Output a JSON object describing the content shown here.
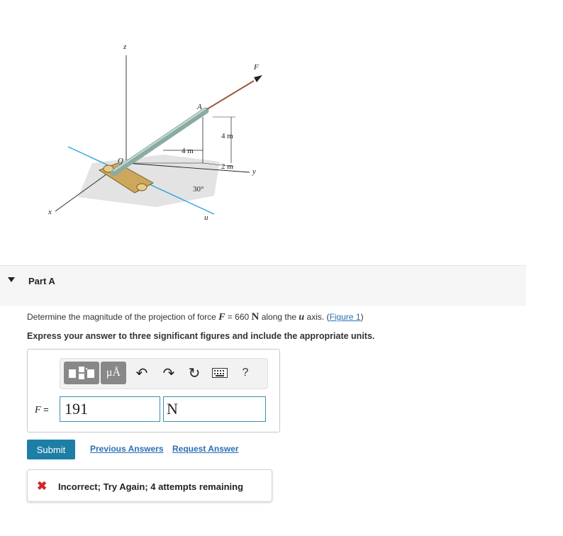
{
  "figure": {
    "labels": {
      "z": "z",
      "x": "x",
      "y": "y",
      "u": "u",
      "O": "O",
      "A": "A",
      "F": "F",
      "dim_4m_horizontal": "4 m",
      "dim_4m_vertical": "4 m",
      "dim_2m": "2 m",
      "angle": "30°"
    }
  },
  "part": {
    "title": "Part A"
  },
  "question": {
    "prefix": "Determine the magnitude of the projection of force ",
    "force_symbol": "F",
    "equals": " = 660 ",
    "unit": "N",
    "along": " along the ",
    "axis_symbol": "u",
    "axis_suffix": " axis. (",
    "figure_link": "Figure 1",
    "close": ")"
  },
  "instruction": "Express your answer to three significant figures and include the appropriate units.",
  "toolbar": {
    "units_label": "μÅ",
    "undo_icon": "↶",
    "redo_icon": "↷",
    "reset_icon": "↻",
    "help_label": "?"
  },
  "answer": {
    "label_symbol": "F",
    "label_suffix": " =",
    "value": "191",
    "unit": "N"
  },
  "buttons": {
    "submit": "Submit",
    "previous_answers": "Previous Answers",
    "request_answer": "Request Answer"
  },
  "feedback": {
    "icon": "✖",
    "text": "Incorrect; Try Again; 4 attempts remaining"
  },
  "colors": {
    "accent": "#1d7fa6",
    "link": "#2a6fb5",
    "error": "#d0262e",
    "u_axis": "#2ba6de"
  }
}
